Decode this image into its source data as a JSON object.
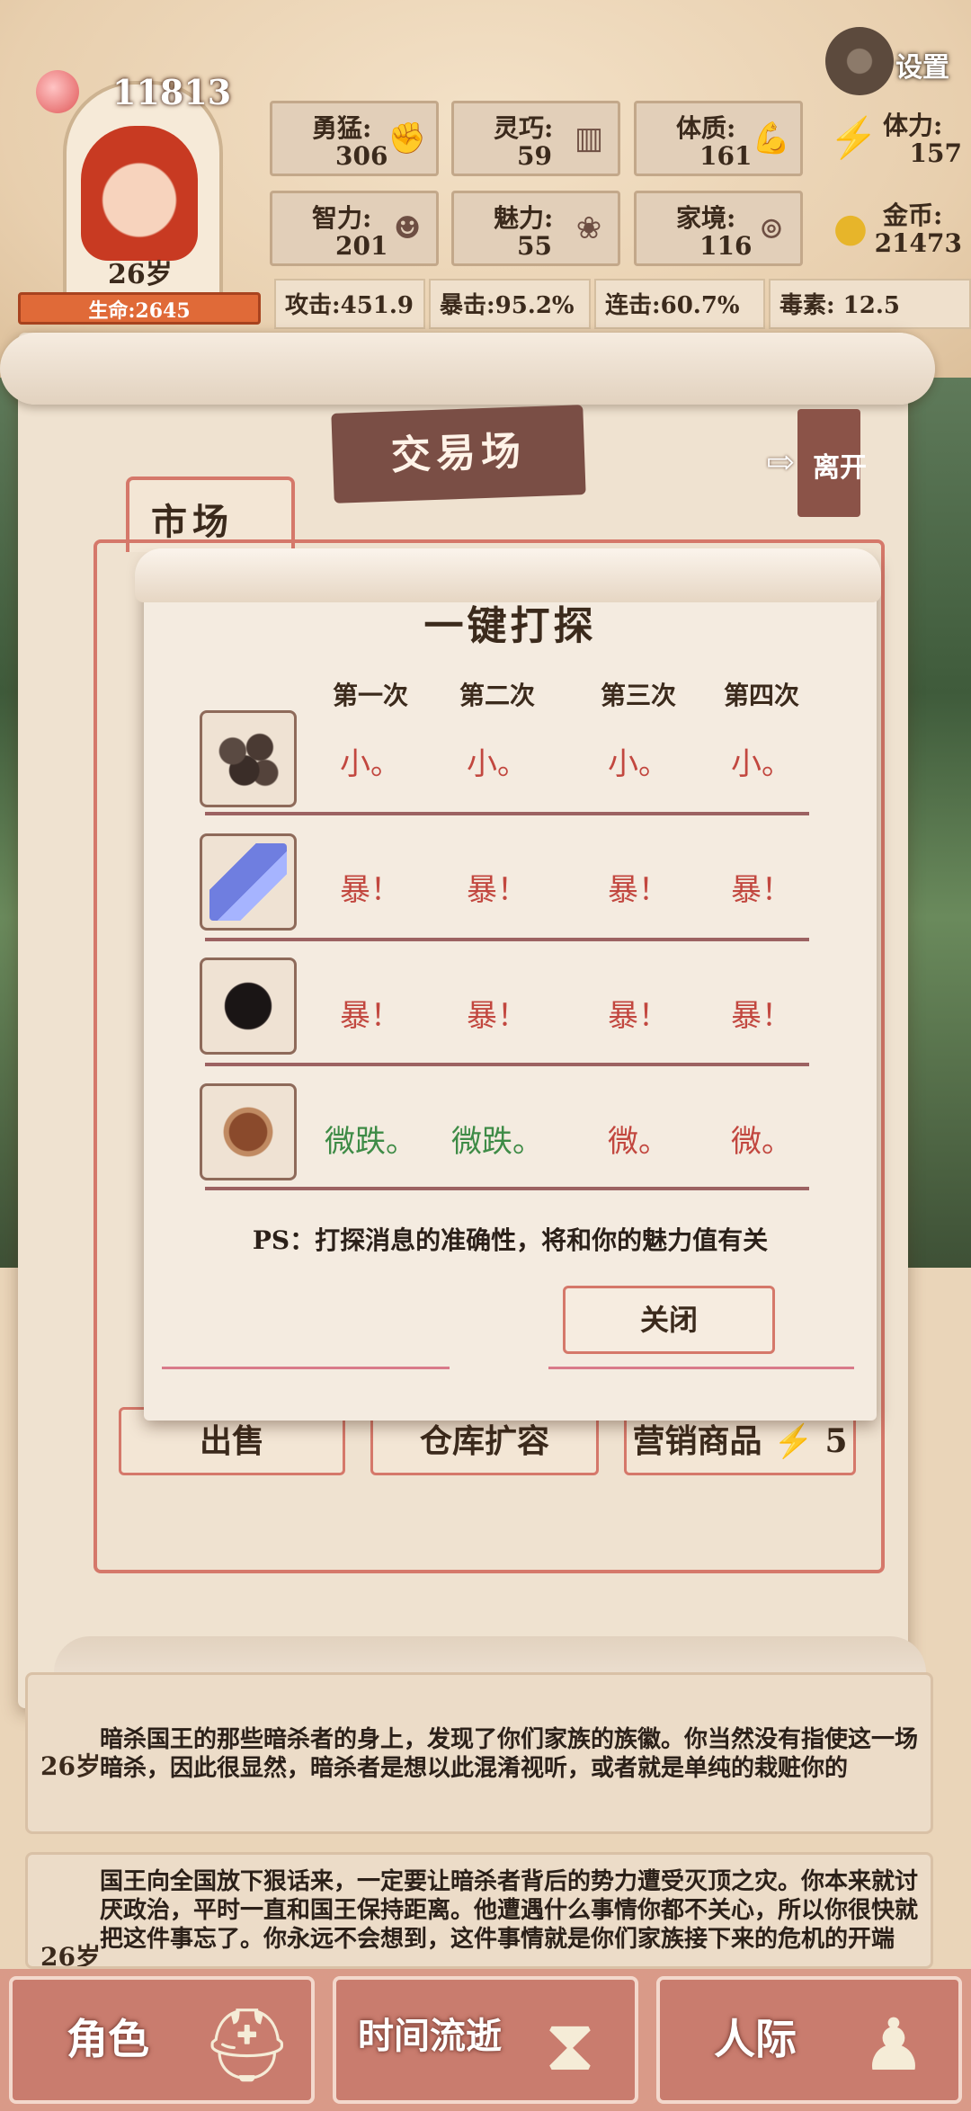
{
  "header": {
    "soul_points": "11813",
    "age": "26岁",
    "hp": "生命:2645",
    "settings_label": "设置"
  },
  "stats": {
    "bravery": {
      "label": "勇猛:",
      "value": "306"
    },
    "agility": {
      "label": "灵巧:",
      "value": "59"
    },
    "constitution": {
      "label": "体质:",
      "value": "161"
    },
    "stamina": {
      "label": "体力:",
      "value": "157"
    },
    "intelligence": {
      "label": "智力:",
      "value": "201"
    },
    "charm": {
      "label": "魅力:",
      "value": "55"
    },
    "family": {
      "label": "家境:",
      "value": "116"
    },
    "gold": {
      "label": "金币:",
      "value": "21473"
    }
  },
  "combat": {
    "attack": "攻击:451.9",
    "crit": "暴击:95.2%",
    "combo": "连击:60.7%",
    "poison": "毒素:  12.5"
  },
  "main": {
    "title": "交易场",
    "leave_label": "离开",
    "market_tab": "市场",
    "actions": {
      "sell": "出售",
      "expand": "仓库扩容",
      "marketing": "营销商品",
      "marketing_cost": "5"
    }
  },
  "modal": {
    "title": "一键打探",
    "columns": [
      "第一次",
      "第二次",
      "第三次",
      "第四次"
    ],
    "rows": [
      {
        "item": "coal-icon",
        "results": [
          "小。",
          "小。",
          "小。",
          "小。"
        ],
        "tone": "red"
      },
      {
        "item": "crystal-icon",
        "results": [
          "暴！",
          "暴！",
          "暴！",
          "暴！"
        ],
        "tone": "red"
      },
      {
        "item": "black-ore-icon",
        "results": [
          "暴！",
          "暴！",
          "暴！",
          "暴！"
        ],
        "tone": "red"
      },
      {
        "item": "hide-icon",
        "results": [
          "微跌。",
          "微跌。",
          "微。",
          "微。"
        ],
        "tones": [
          "green",
          "green",
          "red",
          "red"
        ]
      }
    ],
    "ps": "PS：打探消息的准确性，将和你的魅力值有关",
    "close_label": "关闭"
  },
  "log": [
    {
      "age": "26岁",
      "text": "暗杀国王的那些暗杀者的身上，发现了你们家族的族徽。你当然没有指使这一场暗杀，因此很显然，暗杀者是想以此混淆视听，或者就是单纯的栽赃你的"
    },
    {
      "age": "26岁",
      "text": "国王向全国放下狠话来，一定要让暗杀者背后的势力遭受灭顶之灾。你本来就讨厌政治，平时一直和国王保持距离。他遭遇什么事情你都不关心，所以你很快就把这件事忘了。你永远不会想到，这件事情就是你们家族接下来的危机的开端"
    }
  ],
  "nav": {
    "role": "角色",
    "time": "时间流逝",
    "social": "人际"
  }
}
